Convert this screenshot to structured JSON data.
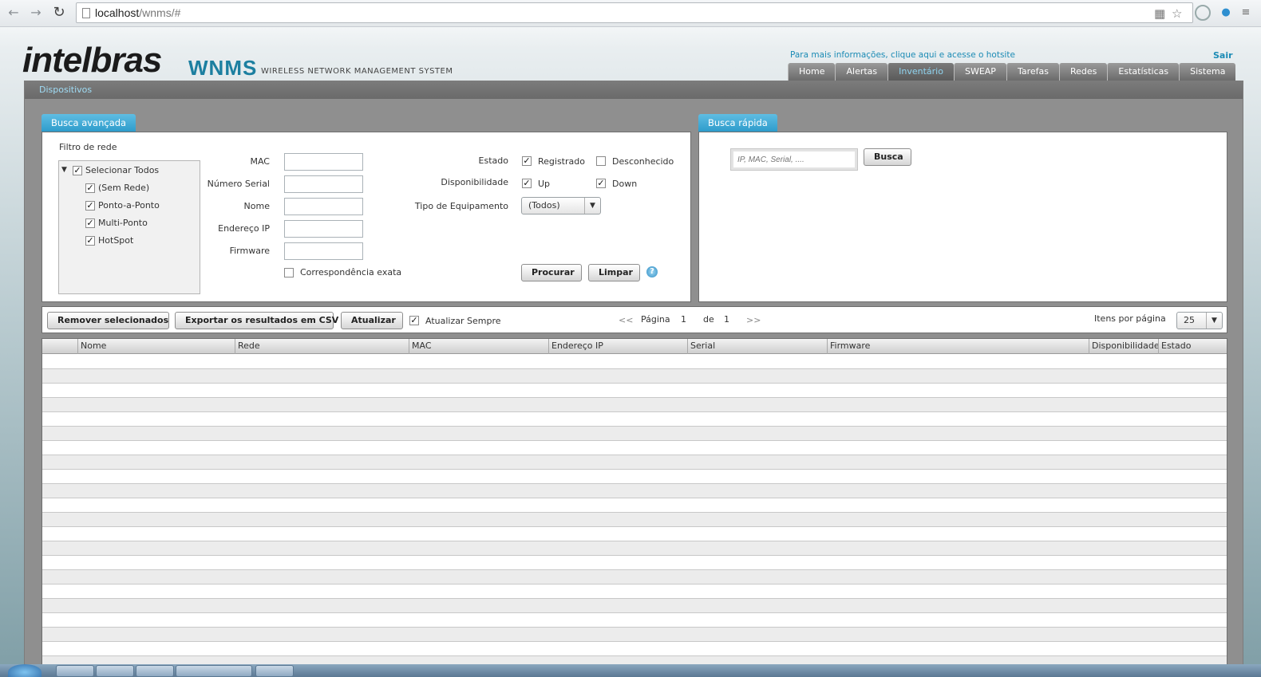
{
  "browser": {
    "url_host": "localhost",
    "url_path": "/wnms/#"
  },
  "header": {
    "logo": "intelbras",
    "product": "WNMS",
    "product_subtitle": "WIRELESS NETWORK MANAGEMENT SYSTEM",
    "hotsite_link": "Para mais informações, clique aqui e acesse o hotsite",
    "logout": "Sair"
  },
  "menu": {
    "items": [
      {
        "label": "Home"
      },
      {
        "label": "Alertas"
      },
      {
        "label": "Inventário"
      },
      {
        "label": "SWEAP"
      },
      {
        "label": "Tarefas"
      },
      {
        "label": "Redes"
      },
      {
        "label": "Estatísticas"
      },
      {
        "label": "Sistema"
      }
    ],
    "active": "Inventário"
  },
  "subbar": {
    "breadcrumb": "Dispositivos"
  },
  "advanced_search": {
    "tab": "Busca avançada",
    "network_filter_label": "Filtro de rede",
    "tree": {
      "root": "Selecionar Todos",
      "children": [
        "(Sem Rede)",
        "Ponto-a-Ponto",
        "Multi-Ponto",
        "HotSpot"
      ]
    },
    "fields": {
      "mac": "MAC",
      "serial": "Número Serial",
      "name": "Nome",
      "ip": "Endereço IP",
      "firmware": "Firmware"
    },
    "exact_match": "Correspondência exata",
    "state_label": "Estado",
    "state_registered": "Registrado",
    "state_unknown": "Desconhecido",
    "availability_label": "Disponibilidade",
    "availability_up": "Up",
    "availability_down": "Down",
    "equipment_type_label": "Tipo de Equipamento",
    "equipment_type_value": "(Todos)",
    "search_button": "Procurar",
    "clear_button": "Limpar",
    "help": "?"
  },
  "quick_search": {
    "tab": "Busca rápida",
    "placeholder": "IP, MAC, Serial, ....",
    "button": "Busca"
  },
  "toolbar": {
    "remove_selected": "Remover selecionados",
    "export_csv": "Exportar os resultados em CSV",
    "refresh": "Atualizar",
    "auto_refresh": "Atualizar Sempre",
    "first": "<<",
    "page_label": "Página",
    "page_current": "1",
    "of_label": "de",
    "page_total": "1",
    "next": ">>",
    "items_per_page_label": "Itens por página",
    "items_per_page": "25"
  },
  "grid": {
    "columns": [
      "",
      "Nome",
      "Rede",
      "MAC",
      "Endereço IP",
      "Serial",
      "Firmware",
      "Disponibilidade",
      "Estado"
    ]
  },
  "colors": {
    "accent": "#2e9ccb",
    "link": "#1b8bb5",
    "brand_wnms": "#1c7fa0"
  }
}
